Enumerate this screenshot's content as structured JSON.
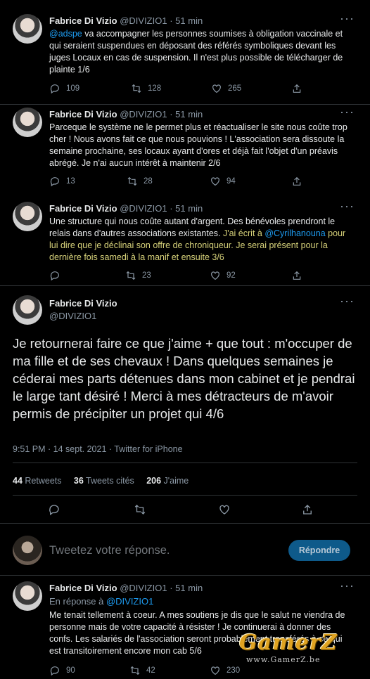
{
  "tweets": [
    {
      "name": "Fabrice Di Vizio",
      "handle": "@DIVIZIO1",
      "dot": "·",
      "time": "51 min",
      "text_parts": [
        "@adspe",
        " va accompagner les personnes soumises à obligation vaccinale et qui seraient suspendues en déposant  des référés symboliques devant les juges Locaux en cas de suspension. Il n'est plus possible de télécharger de plainte 1/6"
      ],
      "replies": "109",
      "retweets": "128",
      "likes": "265"
    },
    {
      "name": "Fabrice Di Vizio",
      "handle": "@DIVIZIO1",
      "dot": "·",
      "time": "51 min",
      "text": "Parceque le système ne le permet plus et réactualiser le site nous coûte trop cher ! Nous avons fait ce que nous pouvions ! L'association sera dissoute la semaine prochaine, ses locaux ayant d'ores et déjà fait l'objet d'un préavis abrégé.  Je n'ai aucun intérêt à maintenir 2/6",
      "replies": "13",
      "retweets": "28",
      "likes": "94"
    },
    {
      "name": "Fabrice Di Vizio",
      "handle": "@DIVIZIO1",
      "dot": "·",
      "time": "51 min",
      "text_parts": [
        "Une structure qui nous coûte autant d'argent. Des bénévoles prendront le relais dans d'autres associations existantes. ",
        "J'ai écrit à ",
        "@Cyrilhanouna",
        " pour lui dire que je déclinai son offre de chroniqueur. Je serai présent pour la dernière fois samedi à la manif et ensuite 3/6"
      ],
      "replies": "",
      "retweets": "23",
      "likes": "92"
    }
  ],
  "main_tweet": {
    "name": "Fabrice Di Vizio",
    "handle": "@DIVIZIO1",
    "text": "Je retournerai faire ce que j'aime + que tout : m'occuper de ma fille et de ses chevaux ! Dans quelques semaines je céderai mes parts détenues dans mon cabinet et je pendrai le large tant désiré ! Merci à mes détracteurs de m'avoir permis de précipiter un projet qui 4/6",
    "meta": "9:51 PM · 14 sept. 2021 · Twitter for iPhone",
    "retweets_count": "44",
    "retweets_label": "Retweets",
    "quotes_count": "36",
    "quotes_label": "Tweets cités",
    "likes_count": "206",
    "likes_label": "J'aime"
  },
  "compose": {
    "placeholder": "Tweetez votre réponse.",
    "button": "Répondre"
  },
  "reply_tweet": {
    "name": "Fabrice Di Vizio",
    "handle": "@DIVIZIO1",
    "dot": "·",
    "time": "51 min",
    "reply_prefix": "En réponse à ",
    "reply_to": "@DIVIZIO1",
    "text": "Me tenait tellement à coeur. A mes soutiens je dis que le salut ne viendra de personne mais de votre capacité à résister ! Je continuerai à donner des confs. Les salariés de l'association seront probablement transférés à ce qui est transitoirement encore  mon cab 5/6",
    "replies": "90",
    "retweets": "42",
    "likes": "230"
  },
  "more_label": "···",
  "watermark": {
    "big": "GamerZ",
    "small": "www.GamerZ.be"
  },
  "colors": {
    "background": "#000000",
    "link": "#1d9bf0",
    "button": "#0e5a8a",
    "watermark": "#e0a321"
  }
}
